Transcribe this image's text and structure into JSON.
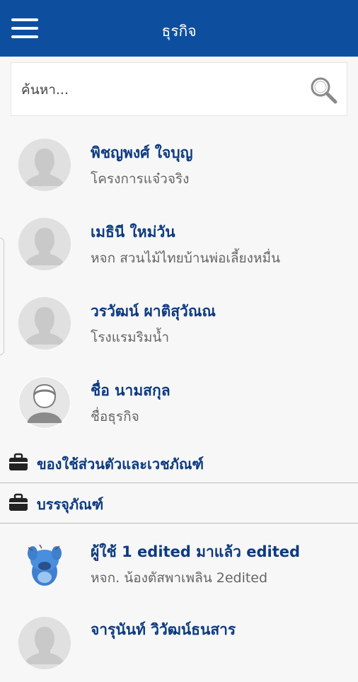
{
  "header": {
    "title": "ธุรกิจ",
    "menu_icon": "hamburger-icon"
  },
  "search": {
    "placeholder": "ค้นหา...",
    "icon": "search-icon"
  },
  "contacts_top": [
    {
      "name": "พิชญพงศ์ ใจบุญ",
      "business": "โครงการแจ๋วจริง"
    },
    {
      "name": "เมธินี ใหม่วัน",
      "business": "หจก สวนไม้ไทยบ้านพ่อเลี้ยงหมื่น"
    },
    {
      "name": "วรวัฒน์ ผาติสุวัณณ",
      "business": "โรงแรมริมน้ำ"
    },
    {
      "name": "ชื่อ นามสกุล",
      "business": "ชื่อธุรกิจ"
    }
  ],
  "sections": [
    {
      "label": "ของใช้ส่วนตัวและเวชภัณฑ์",
      "icon": "briefcase-icon"
    },
    {
      "label": "บรรจุภัณฑ์",
      "icon": "briefcase-icon"
    }
  ],
  "contacts_bottom": [
    {
      "name": "ผู้ใช้ 1 edited มาแล้ว edited",
      "business": "หจก. น้องตัสพาเพลิน 2edited"
    },
    {
      "name": "จารุนันท์ วิวัฒน์ธนสาร",
      "business": ""
    }
  ],
  "colors": {
    "appbar": "#0d4f9e",
    "name_text": "#0d3a80",
    "sub_text": "#666666"
  }
}
